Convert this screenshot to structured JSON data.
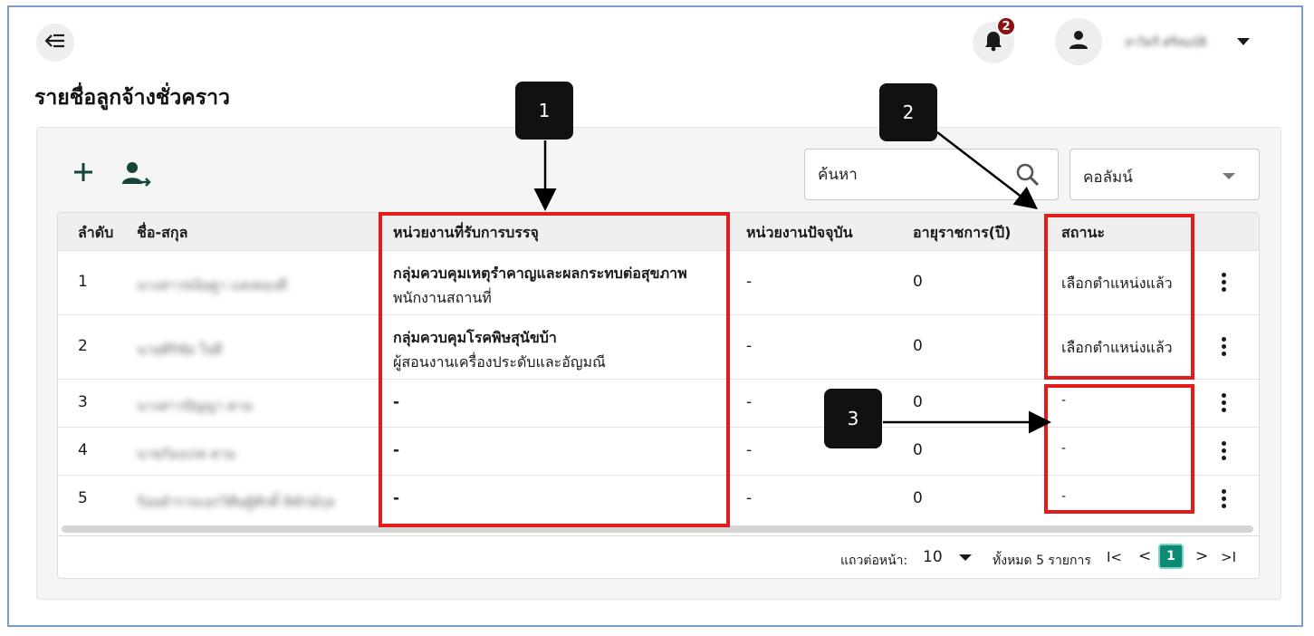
{
  "header": {
    "notification_count": "2",
    "username": "สาวิตรี ศรีสมบัติ",
    "page_title": "รายชื่อลูกจ้างชั่วคราว"
  },
  "toolbar": {
    "search_placeholder": "ค้นหา",
    "column_select_label": "คอลัมน์"
  },
  "table": {
    "headers": [
      "ลำดับ",
      "ชื่อ-สกุล",
      "หน่วยงานที่รับการบรรจุ",
      "หน่วยงานปัจจุบัน",
      "อายุราชการ(ปี)",
      "สถานะ"
    ],
    "rows": [
      {
        "no": "1",
        "name": "นางสาวขนิษฐา แสงทองดี",
        "unit_main": "กลุ่มควบคุมเหตุรำคาญและผลกระทบต่อสุขภาพ",
        "unit_sub": "พนักงานสถานที่",
        "current": "-",
        "years": "0",
        "status": "เลือกตำแหน่งแล้ว"
      },
      {
        "no": "2",
        "name": "นายศิริชัย ใจดี",
        "unit_main": "กลุ่มควบคุมโรคพิษสุนัขบ้า",
        "unit_sub": "ผู้สอนงานเครื่องประดับและอัญมณี",
        "current": "-",
        "years": "0",
        "status": "เลือกตำแหน่งแล้ว"
      },
      {
        "no": "3",
        "name": "นางสาวปัญญา ตาม",
        "unit_main": "-",
        "unit_sub": "",
        "current": "-",
        "years": "0",
        "status": "-"
      },
      {
        "no": "4",
        "name": "นายก้องเกด ตาม",
        "unit_main": "-",
        "unit_sub": "",
        "current": "-",
        "years": "0",
        "status": "-"
      },
      {
        "no": "5",
        "name": "ร้อยตำรวจเอกวิศิษฐ์ศักดิ์ พิทักษ์กุล",
        "unit_main": "-",
        "unit_sub": "",
        "current": "-",
        "years": "0",
        "status": "-"
      }
    ]
  },
  "pagination": {
    "rows_per_page_label": "แถวต่อหน้า:",
    "rows_per_page": "10",
    "total_label": "ทั้งหมด 5 รายการ",
    "first": "I<",
    "prev": "<",
    "current_page": "1",
    "next": ">",
    "last": ">I"
  },
  "annotations": {
    "marker_1": "1",
    "marker_2": "2",
    "marker_3": "3",
    "color": "#e41b1b"
  },
  "colors": {
    "accent": "#0d8a74",
    "badge": "#8b1212",
    "icon_dark": "#14443a"
  }
}
